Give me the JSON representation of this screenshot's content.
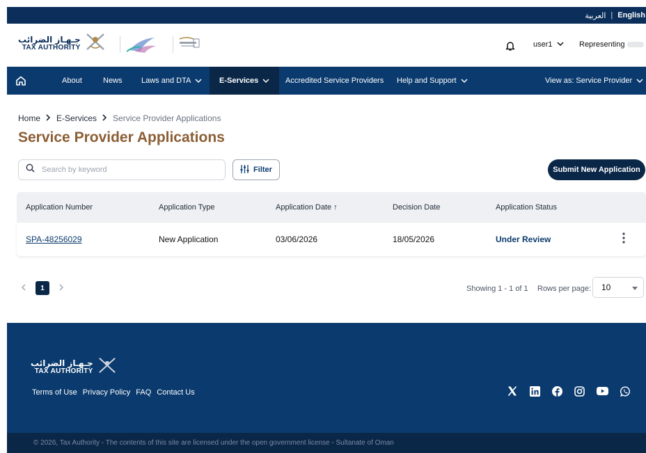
{
  "language": {
    "arabic": "العربية",
    "separator": "|",
    "english": "English"
  },
  "brand": {
    "name_ar": "جـهـاز الضرائب",
    "name_en": "TAX AUTHORITY"
  },
  "header": {
    "user": "user1",
    "representing": "Representing"
  },
  "nav": {
    "items": [
      {
        "label": "About"
      },
      {
        "label": "News"
      },
      {
        "label": "Laws and DTA"
      },
      {
        "label": "E-Services"
      },
      {
        "label": "Accredited Service Providers"
      },
      {
        "label": "Help and Support"
      }
    ],
    "view_as": "View as: Service Provider"
  },
  "breadcrumb": {
    "home": "Home",
    "section": "E-Services",
    "current": "Service Provider Applications"
  },
  "page": {
    "title": "Service Provider Applications"
  },
  "search": {
    "placeholder": "Search by keyword"
  },
  "filter": {
    "label": "Filter"
  },
  "submit": {
    "label": "Submit New Application"
  },
  "table": {
    "columns": [
      "Application Number",
      "Application Type",
      "Application Date",
      "Decision Date",
      "Application Status"
    ],
    "sort_indicator": "↑",
    "rows": [
      {
        "number": "SPA-48256029",
        "type": "New Application",
        "date": "03/06/2026",
        "decision": "18/05/2026",
        "status": "Under Review"
      }
    ]
  },
  "pagination": {
    "current_page": "1",
    "showing": "Showing 1 - 1 of 1",
    "rows_label": "Rows per page:",
    "rows_value": "10"
  },
  "footer": {
    "links": [
      "Terms of Use",
      "Privacy Policy",
      "FAQ",
      "Contact Us"
    ],
    "copyright": "© 2026, Tax Authority - The contents of this site are licensed under the open government license - Sultanate of Oman",
    "socials": [
      "x-icon",
      "linkedin-icon",
      "facebook-icon",
      "instagram-icon",
      "youtube-icon",
      "whatsapp-icon"
    ]
  },
  "colors": {
    "navy": "#0b3b6e",
    "dark_navy": "#0b2748",
    "title_brown": "#8b5e34"
  }
}
